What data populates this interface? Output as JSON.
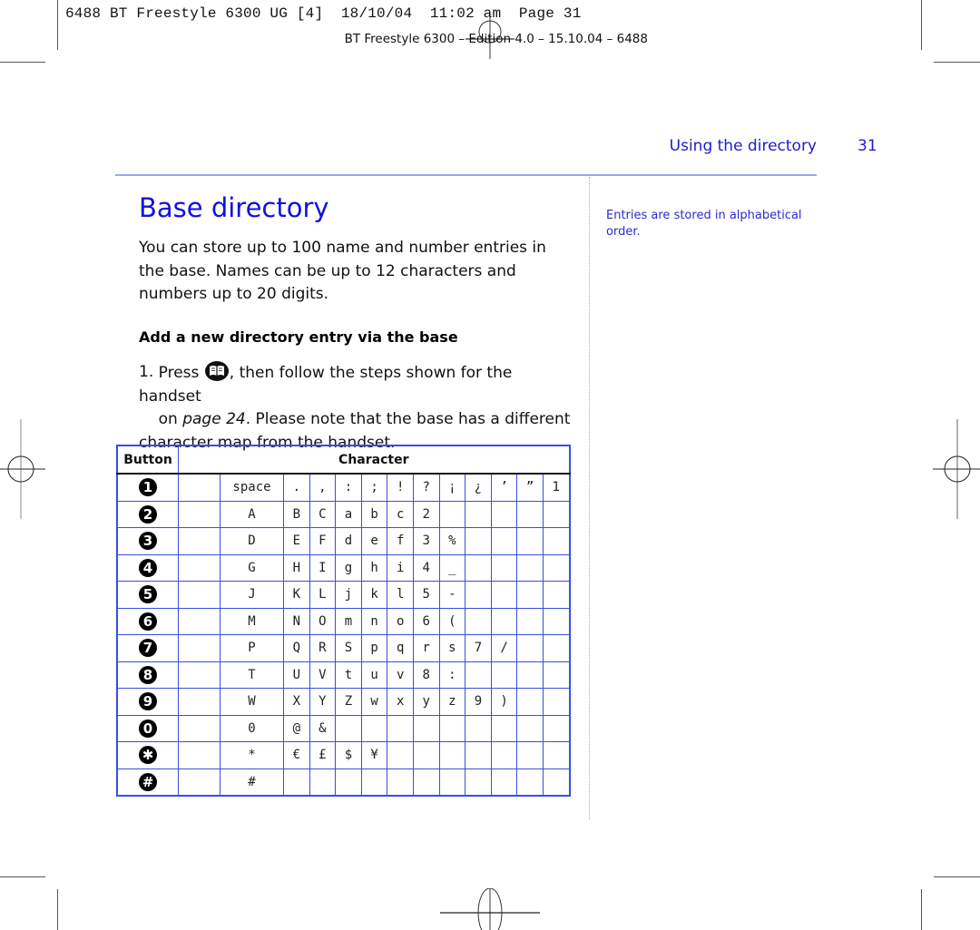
{
  "print_slug": "6488 BT Freestyle 6300 UG [4]  18/10/04  11:02 am  Page 31",
  "edition_line": "BT Freestyle 6300 – Edition 4.0 – 15.10.04 – 6488",
  "running_head": "Using the directory",
  "page_number": "31",
  "sidenote": "Entries are stored in alphabetical order.",
  "section_title": "Base directory",
  "intro": "You can store up to 100 name and number entries in the base. Names can be up to 12 characters and numbers up to 20 digits.",
  "subheading": "Add a new directory entry via the base",
  "step": {
    "number": "1.",
    "text_before_icon": "Press ",
    "icon": "directory-book-icon",
    "text_after_icon": ", then follow the steps shown for the handset",
    "continuation_prefix": "on ",
    "page_ref": "page 24",
    "continuation_suffix": ". Please note that the base has a different character map from the handset."
  },
  "table": {
    "headers": {
      "button": "Button",
      "character": "Character"
    },
    "rows": [
      {
        "key": "1",
        "chars": [
          "space",
          ".",
          ",",
          ":",
          ";",
          "!",
          "?",
          "¡",
          "¿",
          "’",
          "”",
          "1"
        ]
      },
      {
        "key": "2",
        "chars": [
          "A",
          "B",
          "C",
          "a",
          "b",
          "c",
          "2",
          "",
          "",
          "",
          "",
          ""
        ]
      },
      {
        "key": "3",
        "chars": [
          "D",
          "E",
          "F",
          "d",
          "e",
          "f",
          "3",
          "%",
          "",
          "",
          "",
          ""
        ]
      },
      {
        "key": "4",
        "chars": [
          "G",
          "H",
          "I",
          "g",
          "h",
          "i",
          "4",
          "_",
          "",
          "",
          "",
          ""
        ]
      },
      {
        "key": "5",
        "chars": [
          "J",
          "K",
          "L",
          "j",
          "k",
          "l",
          "5",
          "-",
          "",
          "",
          "",
          ""
        ]
      },
      {
        "key": "6",
        "chars": [
          "M",
          "N",
          "O",
          "m",
          "n",
          "o",
          "6",
          "(",
          "",
          "",
          "",
          ""
        ]
      },
      {
        "key": "7",
        "chars": [
          "P",
          "Q",
          "R",
          "S",
          "p",
          "q",
          "r",
          "s",
          "7",
          "/",
          "",
          ""
        ]
      },
      {
        "key": "8",
        "chars": [
          "T",
          "U",
          "V",
          "t",
          "u",
          "v",
          "8",
          ":",
          "",
          "",
          "",
          ""
        ]
      },
      {
        "key": "9",
        "chars": [
          "W",
          "X",
          "Y",
          "Z",
          "w",
          "x",
          "y",
          "z",
          "9",
          ")",
          "",
          ""
        ]
      },
      {
        "key": "0",
        "chars": [
          "0",
          "@",
          "&",
          "",
          "",
          "",
          "",
          "",
          "",
          "",
          "",
          ""
        ]
      },
      {
        "key": "✱",
        "chars": [
          "*",
          "€",
          "£",
          "$",
          "¥",
          "",
          "",
          "",
          "",
          "",
          "",
          ""
        ]
      },
      {
        "key": "#",
        "chars": [
          "#",
          "",
          "",
          "",
          "",
          "",
          "",
          "",
          "",
          "",
          "",
          ""
        ]
      }
    ]
  }
}
